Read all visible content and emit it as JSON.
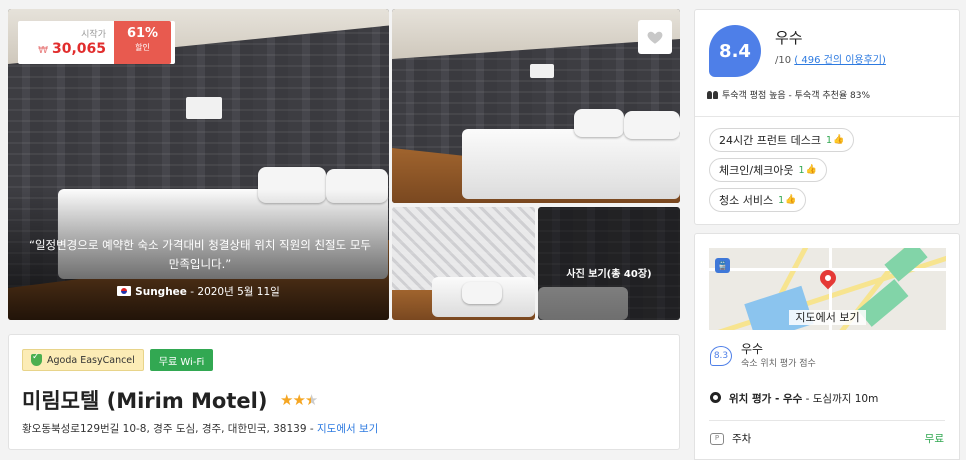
{
  "gallery": {
    "price_label": "시작가",
    "price_currency": "₩",
    "price": "30,065",
    "discount_pct": "61%",
    "discount_label": "할인",
    "quote": "“일정변경으로 예약한 숙소 가격대비 청결상태 위치 직원의 친절도 모두 만족입니다.”",
    "reviewer_name": "Sunghee",
    "review_date": "- 2020년 5월 11일",
    "photo_count": "사진 보기(총 40장)",
    "icons": {
      "favorite": "heart-icon",
      "flag": "korea-flag-icon"
    }
  },
  "info": {
    "badge_cancel": "Agoda EasyCancel",
    "badge_wifi": "무료 Wi-Fi",
    "hotel_name": "미림모텔 (Mirim Motel)",
    "star_rating": 2.5,
    "address": "황오동북성로129번길 10-8, 경주 도심, 경주, 대한민국, 38139 - ",
    "map_link": "지도에서 보기"
  },
  "review": {
    "score": "8.4",
    "score_word": "우수",
    "score_out_of": "/10 ",
    "review_count_link": "( 496 건의 이용후기)",
    "traveler_line": "투숙객 평점 높음 - 투숙객 추천율 83%",
    "chips": [
      {
        "label": "24시간 프런트 데스크",
        "count": "1"
      },
      {
        "label": "체크인/체크아웃",
        "count": "1"
      },
      {
        "label": "청소 서비스",
        "count": "1"
      }
    ]
  },
  "location": {
    "map_button": "지도에서 보기",
    "score": "8.3",
    "score_word": "우수",
    "score_sub": "숙소 위치 평가 점수",
    "rating_line_bold": "위치 평가 - 우수",
    "rating_line_rest": " - 도심까지 10m",
    "parking_label": "주차",
    "parking_value": "무료"
  },
  "colors": {
    "accent_blue": "#4e7fe8",
    "discount_red": "#e85a4f",
    "price_red": "#e12d2d",
    "wifi_green": "#32a852",
    "star_gold": "#f5a623"
  }
}
